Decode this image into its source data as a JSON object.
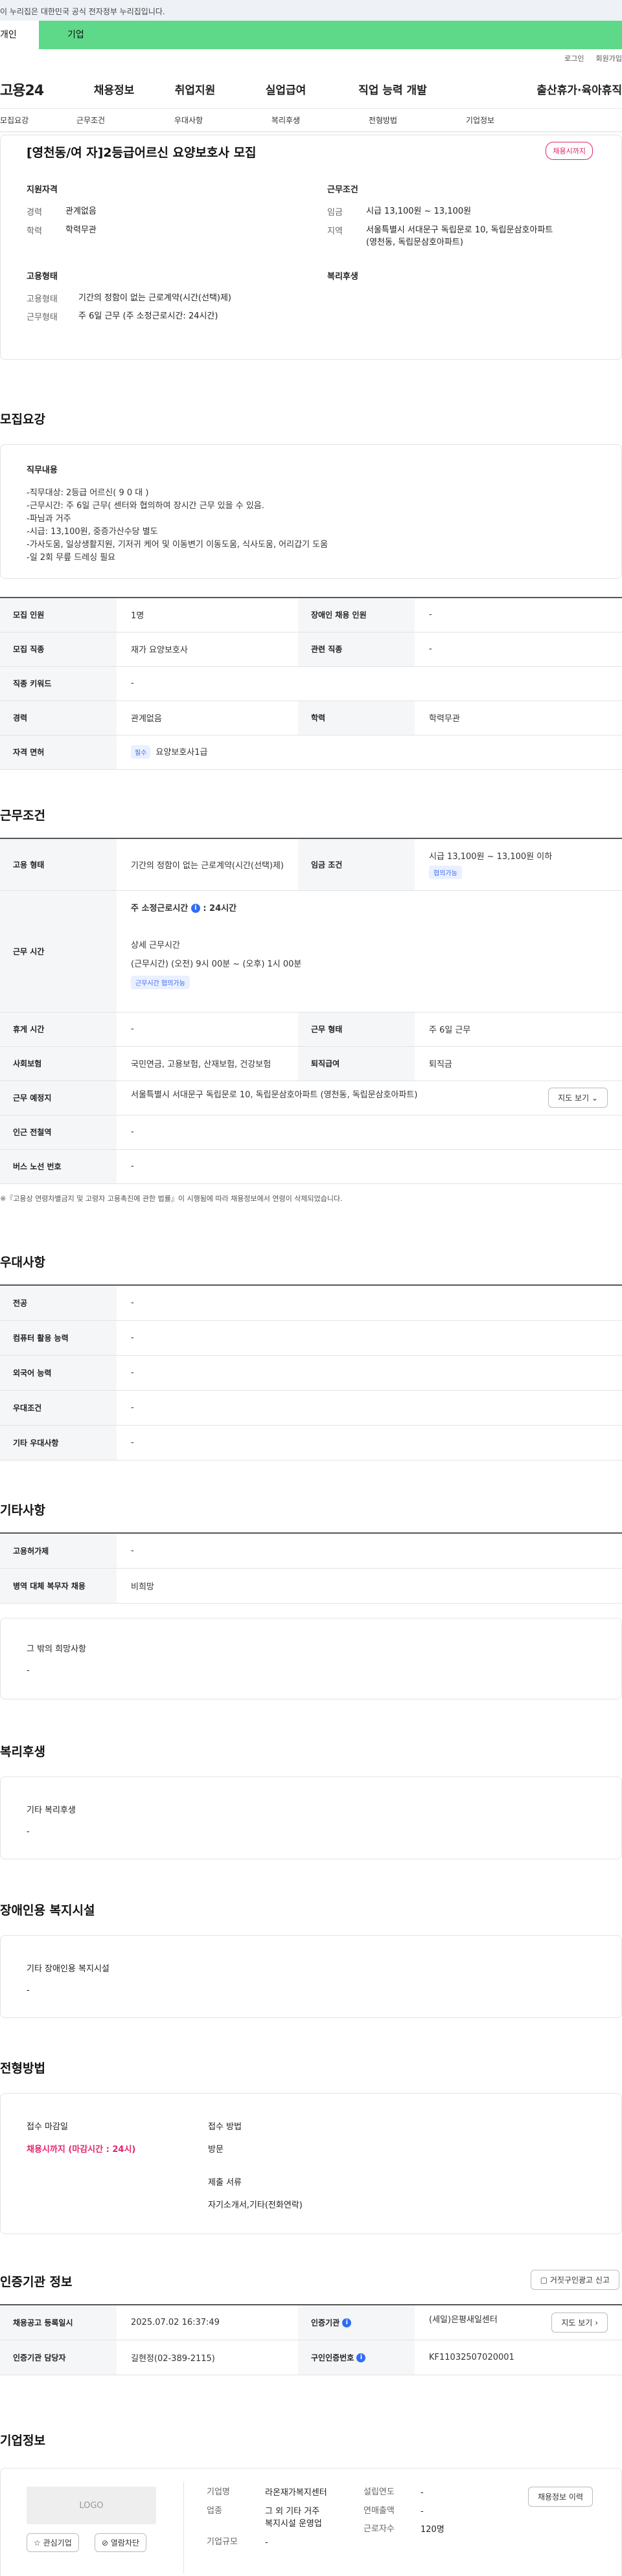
{
  "topbar": {
    "notice": "이 누리집은 대한민국 공식 전자정부 누리집입니다."
  },
  "user_tabs": {
    "personal": "개인",
    "company": "기업"
  },
  "util": {
    "login": "로그인",
    "join": "회원가입"
  },
  "gnb": {
    "logo": "고용24",
    "items": [
      "채용정보",
      "취업지원",
      "실업급여",
      "직업 능력 개발",
      "출산휴가·육아휴직"
    ]
  },
  "subtabs": [
    "모집요강",
    "근무조건",
    "우대사항",
    "복리후생",
    "전형방법",
    "기업정보"
  ],
  "summary": {
    "title": "[영천동/여 자]2등급어르신 요양보호사 모집",
    "badge": "채용시까지",
    "qual_head": "지원자격",
    "career_k": "경력",
    "career_v": "관계없음",
    "edu_k": "학력",
    "edu_v": "학력무관",
    "work_head": "근무조건",
    "wage_k": "임금",
    "wage_v": "시급 13,100원 ~ 13,100원",
    "area_k": "지역",
    "area_v1": "서울특별시 서대문구 독립문로 10, 독립문삼호아파트",
    "area_v2": "(영천동, 독립문삼호아파트)",
    "emp_head": "고용형태",
    "emp_k": "고용형태",
    "emp_v": "기간의 정함이 없는 근로계약(시간(선택)제)",
    "form_k": "근무형태",
    "form_v": "주 6일 근무 (주 소정근로시간: 24시간)",
    "welfare_head": "복리후생"
  },
  "recruit": {
    "heading": "모집요강",
    "duty_title": "직무내용",
    "duty_text": "-직무대상: 2등급 어르신( 9 0 대 )\n-근무시간: 주 6일 근무( 센터와 협의하여 장시간 근무 있을 수 있음.\n-파님과 거주\n-시급: 13,100원, 중증가산수당 별도\n-가사도움, 일상생활지원, 기저귀 케어 및 이동변기 이동도움, 식사도움, 어리갑기 도움\n-일 2회 무릎 드레싱 필요",
    "rows": [
      {
        "k1": "모집 인원",
        "v1": "1명",
        "k2": "장애인 채용 인원",
        "v2": "-"
      },
      {
        "k1": "모집 직종",
        "v1": "재가 요양보호사",
        "k2": "관련 직종",
        "v2": "-"
      },
      {
        "k1": "직종 키워드",
        "v1": "-"
      },
      {
        "k1": "경력",
        "v1": "관계없음",
        "k2": "학력",
        "v2": "학력무관"
      },
      {
        "k1": "자격 면허",
        "v1_chip": "필수",
        "v1": "요양보호사1급"
      }
    ]
  },
  "condition": {
    "heading": "근무조건",
    "emp_k": "고용 형태",
    "emp_v": "기간의 정함이 없는 근로계약(시간(선택)제)",
    "wage_k": "임금 조건",
    "wage_v": "시급 13,100원 ~ 13,100원 이하",
    "wage_pill": "협의가능",
    "time_k": "근무 시간",
    "time_main_a": "주 소정근로시간",
    "time_main_b": ": 24시간",
    "time_detail_head": "상세 근무시간",
    "time_detail": "(근무시간) (오전) 9시 00분 ~ (오후) 1시 00분",
    "time_pill": "근무시간 협의가능",
    "rest_k": "휴게 시간",
    "rest_v": "-",
    "form_k": "근무 형태",
    "form_v": "주 6일 근무",
    "ins_k": "사회보험",
    "ins_v": "국민연금, 고용보험, 산재보험, 건강보험",
    "sev_k": "퇴직급여",
    "sev_v": "퇴직금",
    "place_k": "근무 예정지",
    "place_v": "서울특별시 서대문구 독립문로 10, 독립문삼호아파트 (영천동, 독립문삼호아파트)",
    "map_btn": "지도 보기",
    "subway_k": "인근 전철역",
    "subway_v": "-",
    "bus_k": "버스 노선 번호",
    "bus_v": "-",
    "note": "※『고용상 연령차별금지 및 고령자 고용촉진에 관한 법률』이 시행됨에 따라 채용정보에서 연령이 삭제되었습니다."
  },
  "prefer": {
    "heading": "우대사항",
    "rows": [
      {
        "k": "전공",
        "v": "-"
      },
      {
        "k": "컴퓨터 활용 능력",
        "v": "-"
      },
      {
        "k": "외국어 능력",
        "v": "-"
      },
      {
        "k": "우대조건",
        "v": "-"
      },
      {
        "k": "기타 우대사항",
        "v": "-"
      }
    ]
  },
  "etc": {
    "heading": "기타사항",
    "rows": [
      {
        "k": "고용허가제",
        "v": "-"
      },
      {
        "k": "병역 대체 복무자 채용",
        "v": "비희망"
      }
    ],
    "box_title": "그 밖의 희망사항",
    "box_v": "-"
  },
  "welfare": {
    "heading": "복리후생",
    "box_title": "기타 복리후생",
    "box_v": "-"
  },
  "disability": {
    "heading": "장애인용 복지시설",
    "box_title": "기타 장애인용 복지시설",
    "box_v": "-"
  },
  "selection": {
    "heading": "전형방법",
    "deadline_head": "접수 마감일",
    "deadline_v": "채용시까지 (마감시간 : 24시)",
    "method_head": "접수 방법",
    "method_v": "방문",
    "docs_head": "제출 서류",
    "docs_v": "자기소개서,기타(전화연락)"
  },
  "agency": {
    "heading": "인증기관 정보",
    "report_btn": "거짓구인광고 신고",
    "reg_k": "채용공고 등록일시",
    "reg_v": "2025.07.02 16:37:49",
    "org_k": "인증기관",
    "org_v": "(세일)은평새일센터",
    "map_btn": "지도 보기",
    "mgr_k": "인증기관 담당자",
    "mgr_v": "길현정(02-389-2115)",
    "no_k": "구인인증번호",
    "no_v": "KF11032507020001"
  },
  "company": {
    "heading": "기업정보",
    "logo": "LOGO",
    "fav_btn": "관심기업",
    "block_btn": "열람차단",
    "name_k": "기업명",
    "name_v": "라온재가복지센터",
    "ind_k": "업종",
    "ind_v1": "그 외 기타 거주",
    "ind_v2": "복지시설 운영업",
    "size_k": "기업규모",
    "size_v": "-",
    "est_k": "설립연도",
    "est_v": "-",
    "sales_k": "연매출액",
    "sales_v": "-",
    "emp_k": "근로자수",
    "emp_v": "120명",
    "hist_btn": "채용정보 이력"
  }
}
